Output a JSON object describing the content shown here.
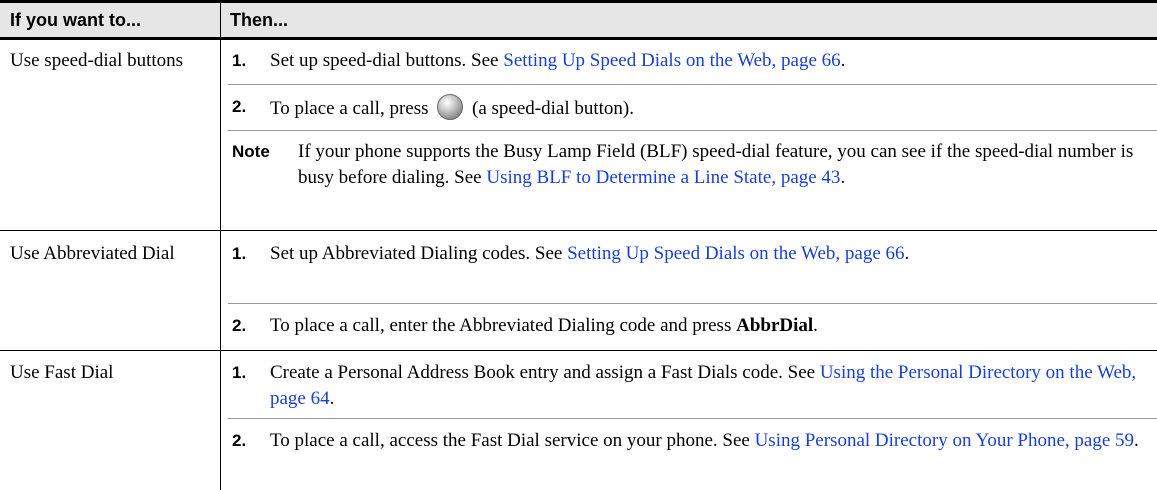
{
  "header": {
    "col1": "If you want to...",
    "col2": "Then..."
  },
  "rows": [
    {
      "action": "Use speed-dial buttons",
      "steps": [
        {
          "num": "1.",
          "text": "Set up speed-dial buttons. See ",
          "link": "Setting Up Speed Dials on the Web, page 66",
          "after": "."
        },
        {
          "num": "2.",
          "text_before": "To place a call, press ",
          "icon": "speed-dial-button-icon",
          "text_after": " (a speed-dial button)."
        }
      ],
      "note": {
        "label": "Note",
        "text": "If your phone supports the Busy Lamp Field (BLF) speed-dial feature, you can see if the speed-dial number is busy before dialing. See ",
        "link": "Using BLF to Determine a Line State, page 43",
        "after": "."
      }
    },
    {
      "action": "Use Abbreviated Dial",
      "steps": [
        {
          "num": "1.",
          "text": "Set up Abbreviated Dialing codes. See ",
          "link": "Setting Up Speed Dials on the Web, page 66",
          "after": "."
        },
        {
          "num": "2.",
          "text": "To place a call, enter the Abbreviated Dialing code and press ",
          "bold": "AbbrDial",
          "after": "."
        }
      ]
    },
    {
      "action": "Use Fast Dial",
      "steps": [
        {
          "num": "1.",
          "text": "Create a Personal Address Book entry and assign a Fast Dials code. See ",
          "link": "Using the Personal Directory on the Web, page 64",
          "after": "."
        },
        {
          "num": "2.",
          "text": "To place a call, access the Fast Dial service on your phone. See ",
          "link": "Using Personal Directory on Your Phone, page 59",
          "after": "."
        }
      ]
    }
  ]
}
